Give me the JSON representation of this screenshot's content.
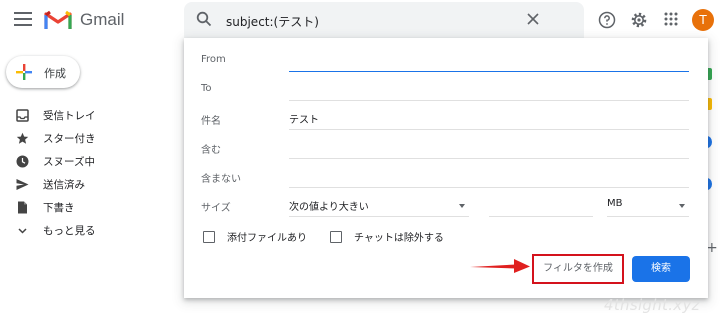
{
  "app": {
    "logo_text": "Gmail"
  },
  "search": {
    "query": "subject:(テスト)"
  },
  "header": {
    "avatar_letter": "T"
  },
  "compose": {
    "label": "作成"
  },
  "nav": {
    "items": [
      {
        "label": "受信トレイ",
        "icon": "inbox-icon"
      },
      {
        "label": "スター付き",
        "icon": "star-icon"
      },
      {
        "label": "スヌーズ中",
        "icon": "clock-icon"
      },
      {
        "label": "送信済み",
        "icon": "send-icon"
      },
      {
        "label": "下書き",
        "icon": "draft-icon"
      },
      {
        "label": "もっと見る",
        "icon": "chevron-down-icon"
      }
    ]
  },
  "filter": {
    "from_label": "From",
    "to_label": "To",
    "subject_label": "件名",
    "subject_value": "テスト",
    "has_words_label": "含む",
    "not_words_label": "含まない",
    "size_label": "サイズ",
    "size_operator": "次の値より大きい",
    "size_unit": "MB",
    "has_attachment_label": "添付ファイルあり",
    "exclude_chats_label": "チャットは除外する",
    "create_filter_label": "フィルタを作成",
    "search_button_label": "検索"
  },
  "watermark": "4thsight.xyz",
  "colors": {
    "accent": "#1a73e8",
    "highlight": "#d4121c",
    "avatar": "#e8710a"
  }
}
